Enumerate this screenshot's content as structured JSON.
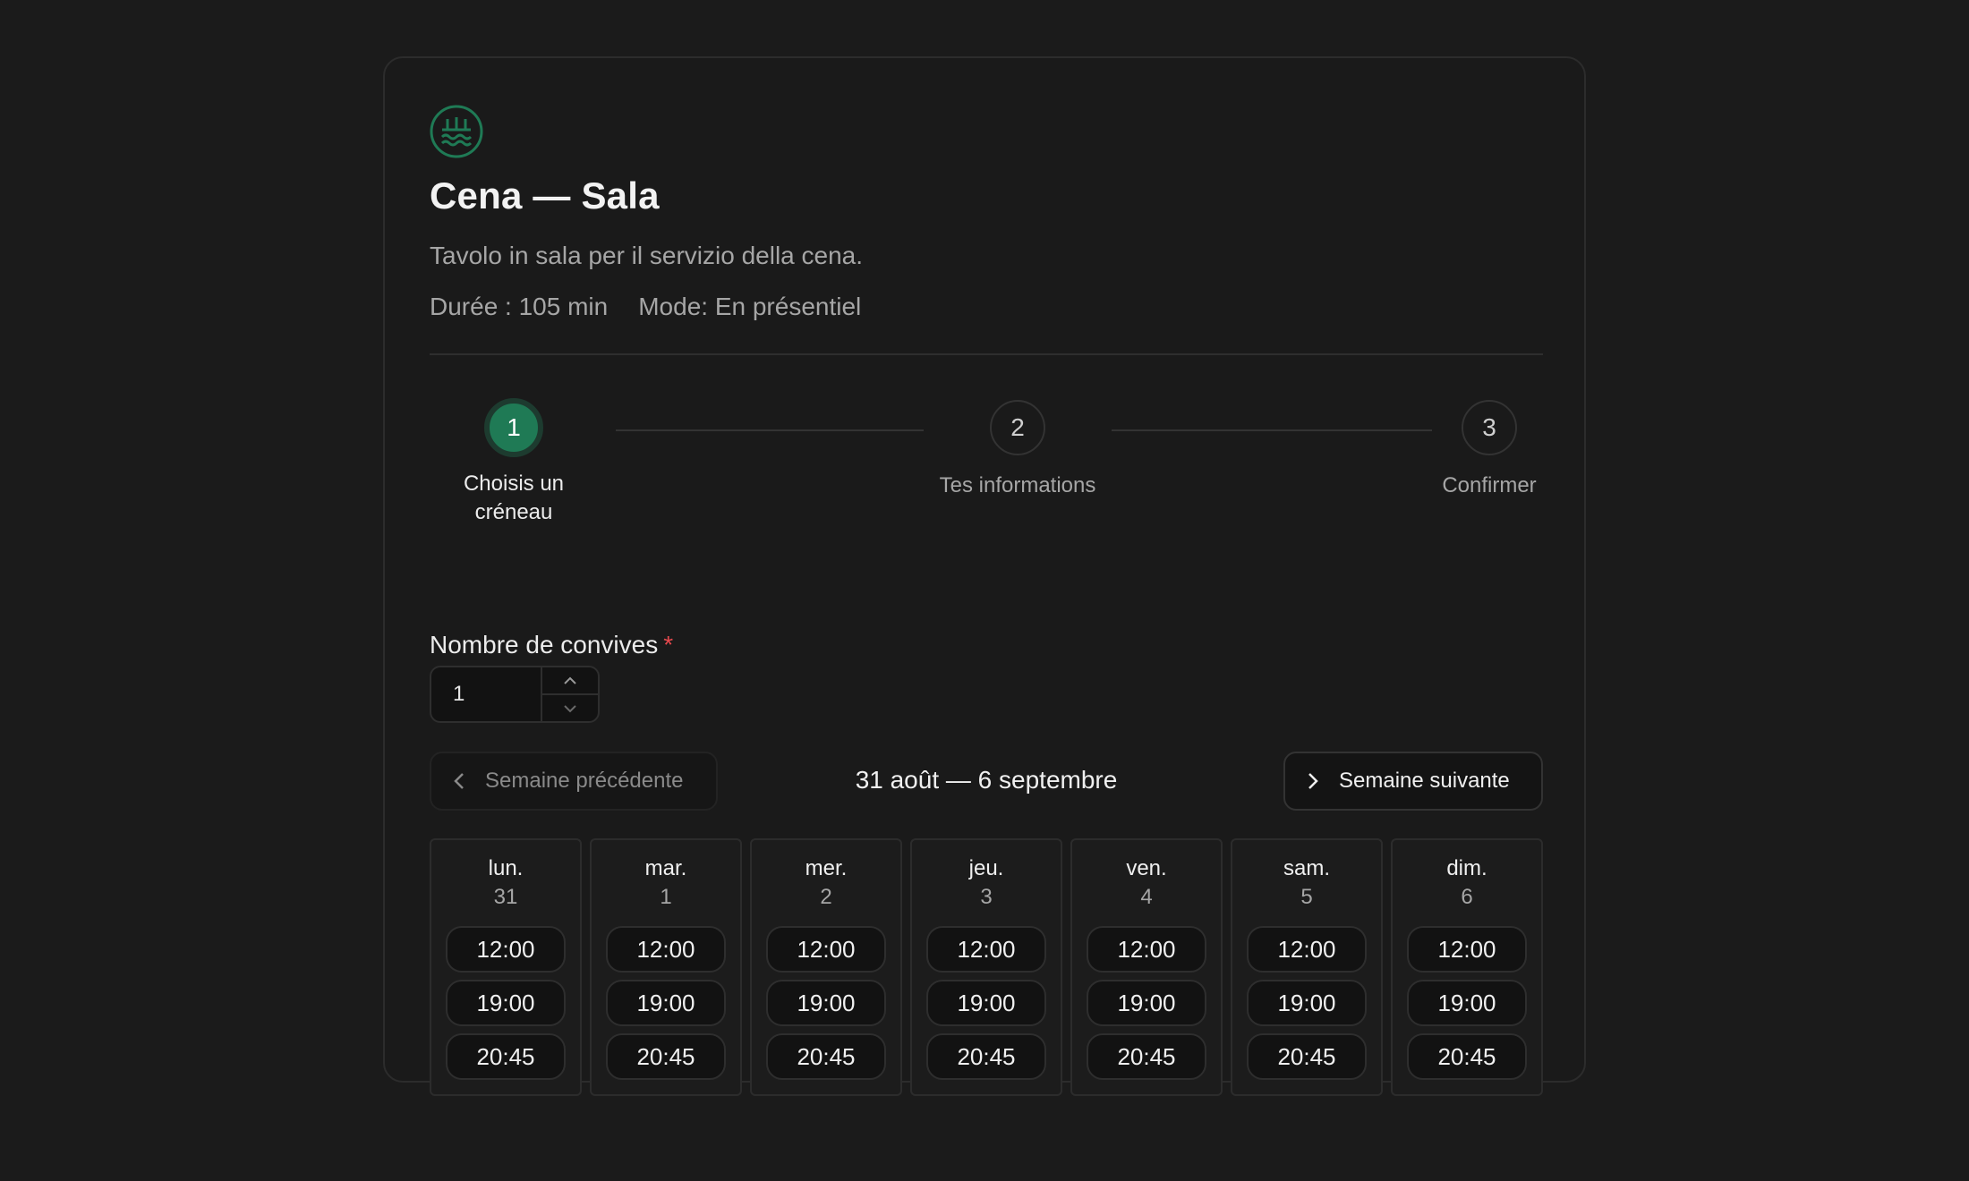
{
  "service": {
    "icon": "restaurant-waves-icon",
    "title": "Cena — Sala",
    "description": "Tavolo in sala per il servizio della cena.",
    "duration": "Durée : 105 min",
    "mode": "Mode: En présentiel"
  },
  "colors": {
    "accent": "#1f7a55",
    "required": "#e5484d",
    "background": "#1b1b1b"
  },
  "steps": [
    {
      "number": "1",
      "label": "Choisis un créneau",
      "active": true
    },
    {
      "number": "2",
      "label": "Tes informations",
      "active": false
    },
    {
      "number": "3",
      "label": "Confirmer",
      "active": false
    }
  ],
  "guests": {
    "label": "Nombre de convives",
    "required_mark": "*",
    "value": "1"
  },
  "week": {
    "prev_label": "Semaine précédente",
    "next_label": "Semaine suivante",
    "range": "31 août — 6 septembre"
  },
  "days": [
    {
      "name": "lun.",
      "num": "31",
      "slots": [
        "12:00",
        "19:00",
        "20:45"
      ]
    },
    {
      "name": "mar.",
      "num": "1",
      "slots": [
        "12:00",
        "19:00",
        "20:45"
      ]
    },
    {
      "name": "mer.",
      "num": "2",
      "slots": [
        "12:00",
        "19:00",
        "20:45"
      ]
    },
    {
      "name": "jeu.",
      "num": "3",
      "slots": [
        "12:00",
        "19:00",
        "20:45"
      ]
    },
    {
      "name": "ven.",
      "num": "4",
      "slots": [
        "12:00",
        "19:00",
        "20:45"
      ]
    },
    {
      "name": "sam.",
      "num": "5",
      "slots": [
        "12:00",
        "19:00",
        "20:45"
      ]
    },
    {
      "name": "dim.",
      "num": "6",
      "slots": [
        "12:00",
        "19:00",
        "20:45"
      ]
    }
  ]
}
